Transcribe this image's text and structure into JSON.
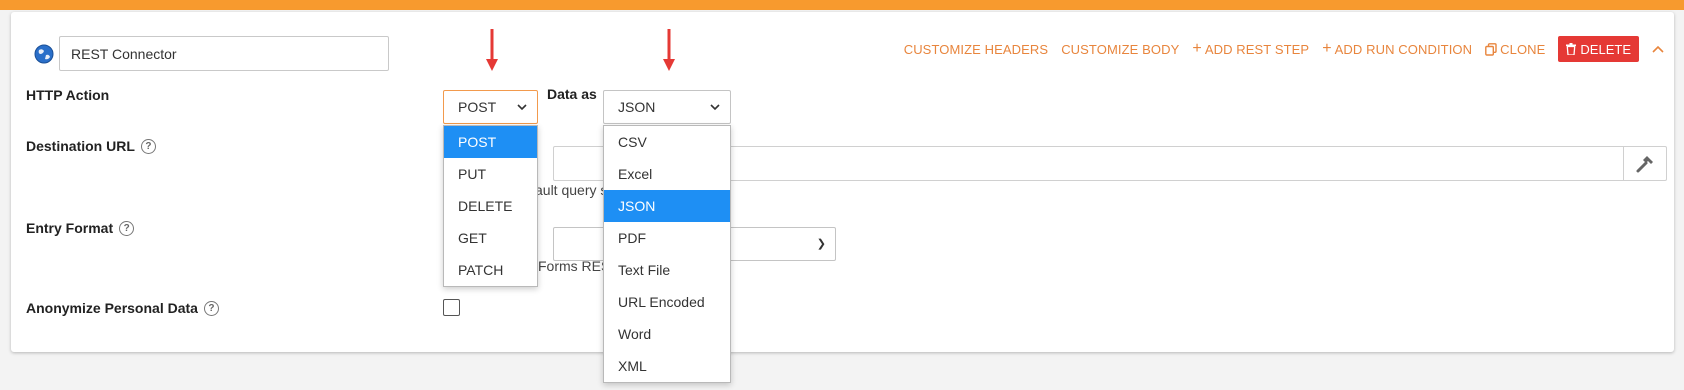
{
  "header": {
    "connector_name": "REST Connector",
    "actions": {
      "customize_headers": "CUSTOMIZE HEADERS",
      "customize_body": "CUSTOMIZE BODY",
      "add_rest_step": "ADD REST STEP",
      "add_run_condition": "ADD RUN CONDITION",
      "clone": "CLONE",
      "delete": "DELETE"
    }
  },
  "form": {
    "http_action": {
      "label": "HTTP Action",
      "value": "POST",
      "options": [
        "POST",
        "PUT",
        "DELETE",
        "GET",
        "PATCH"
      ],
      "selected_index": 0
    },
    "data_as": {
      "label": "Data as",
      "value": "JSON",
      "options": [
        "CSV",
        "Excel",
        "JSON",
        "PDF",
        "Text File",
        "URL Encoded",
        "Word",
        "XML"
      ],
      "selected_index": 2
    },
    "destination_url": {
      "label": "Destination URL",
      "value": "",
      "hint_partial": "ault query s"
    },
    "entry_format": {
      "label": "Entry Format",
      "value": "",
      "hint_partial": "Forms RES"
    },
    "anonymize": {
      "label": "Anonymize Personal Data",
      "checked": false
    }
  },
  "colors": {
    "accent": "#f79a2e",
    "link": "#e8853d",
    "delete": "#e53935",
    "selected": "#1e8ff4",
    "annotation_arrow": "#e53935"
  },
  "icons": {
    "connector": "globe-icon",
    "clone": "copy-icon",
    "delete": "trash-icon",
    "collapse": "chevron-up-icon",
    "url_builder": "hammer-icon",
    "help": "question-circle-icon"
  }
}
